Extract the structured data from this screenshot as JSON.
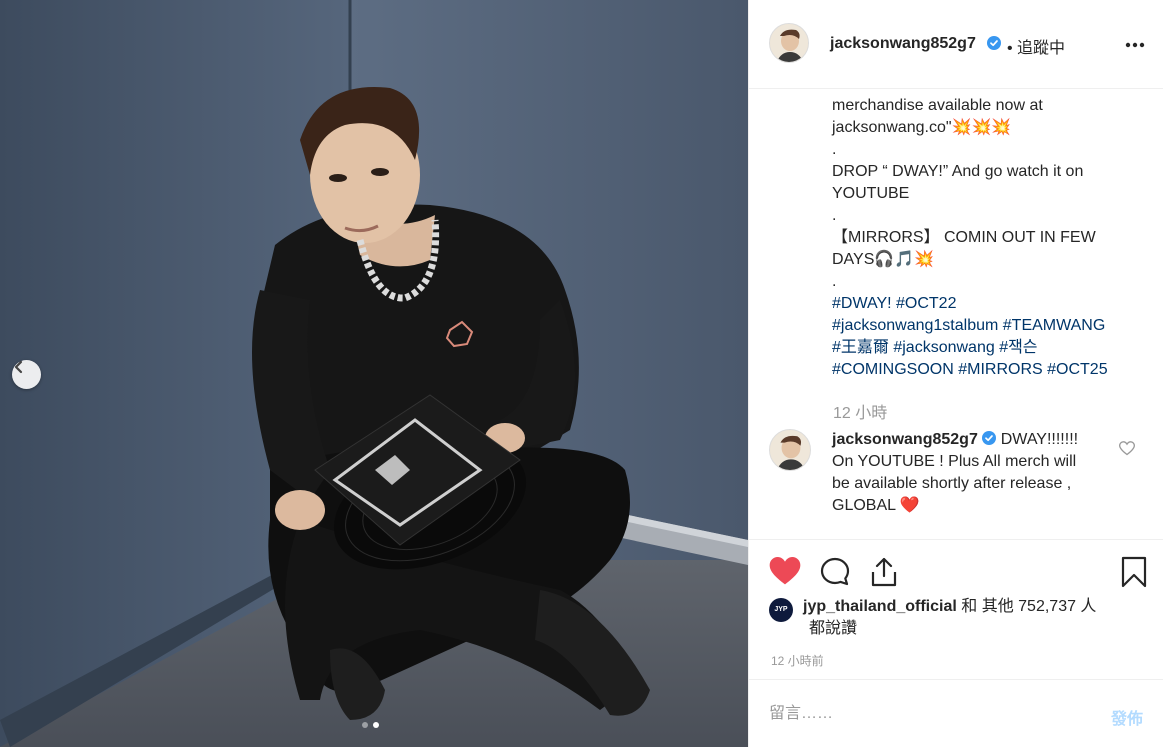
{
  "post": {
    "username": "jacksonwang852g7",
    "follow_status": "• 追蹤中",
    "more_icon": "more-horizontal-icon",
    "caption_lines": [
      "merchandise available now at",
      "jacksonwang.co\"💥💥💥",
      ".",
      "DROP “ DWAY!” And go watch it on",
      "YOUTUBE",
      ".",
      "【MIRRORS】 COMIN OUT IN FEW",
      "DAYS🎧🎵💥",
      "."
    ],
    "hashtag_lines": [
      "#DWAY! #OCT22",
      "#jacksonwang1stalbum #TEAMWANG",
      "#王嘉爾 #jacksonwang #잭슨",
      "#COMINGSOON #MIRRORS #OCT25"
    ],
    "caption_time": "12 小時",
    "reply": {
      "username": "jacksonwang852g7",
      "text_lines": [
        "DWAY!!!!!!!",
        "On YOUTUBE ! Plus All merch will",
        "be available shortly after release ,",
        "GLOBAL ❤️"
      ]
    },
    "likes": {
      "account": "jyp_thailand_official",
      "line1_rest": " 和 其他 752,737 人",
      "line2": "都說讚",
      "avatar_text": "JYP"
    },
    "posted_time": "12 小時前",
    "composer": {
      "placeholder": "留言……",
      "post_label": "發佈"
    }
  },
  "carousel": {
    "total": 2,
    "active": 2
  },
  "colors": {
    "like_red": "#ed4956",
    "verified_blue": "#3897f0",
    "hashtag": "#003569",
    "wall": "#4a5a6e"
  }
}
